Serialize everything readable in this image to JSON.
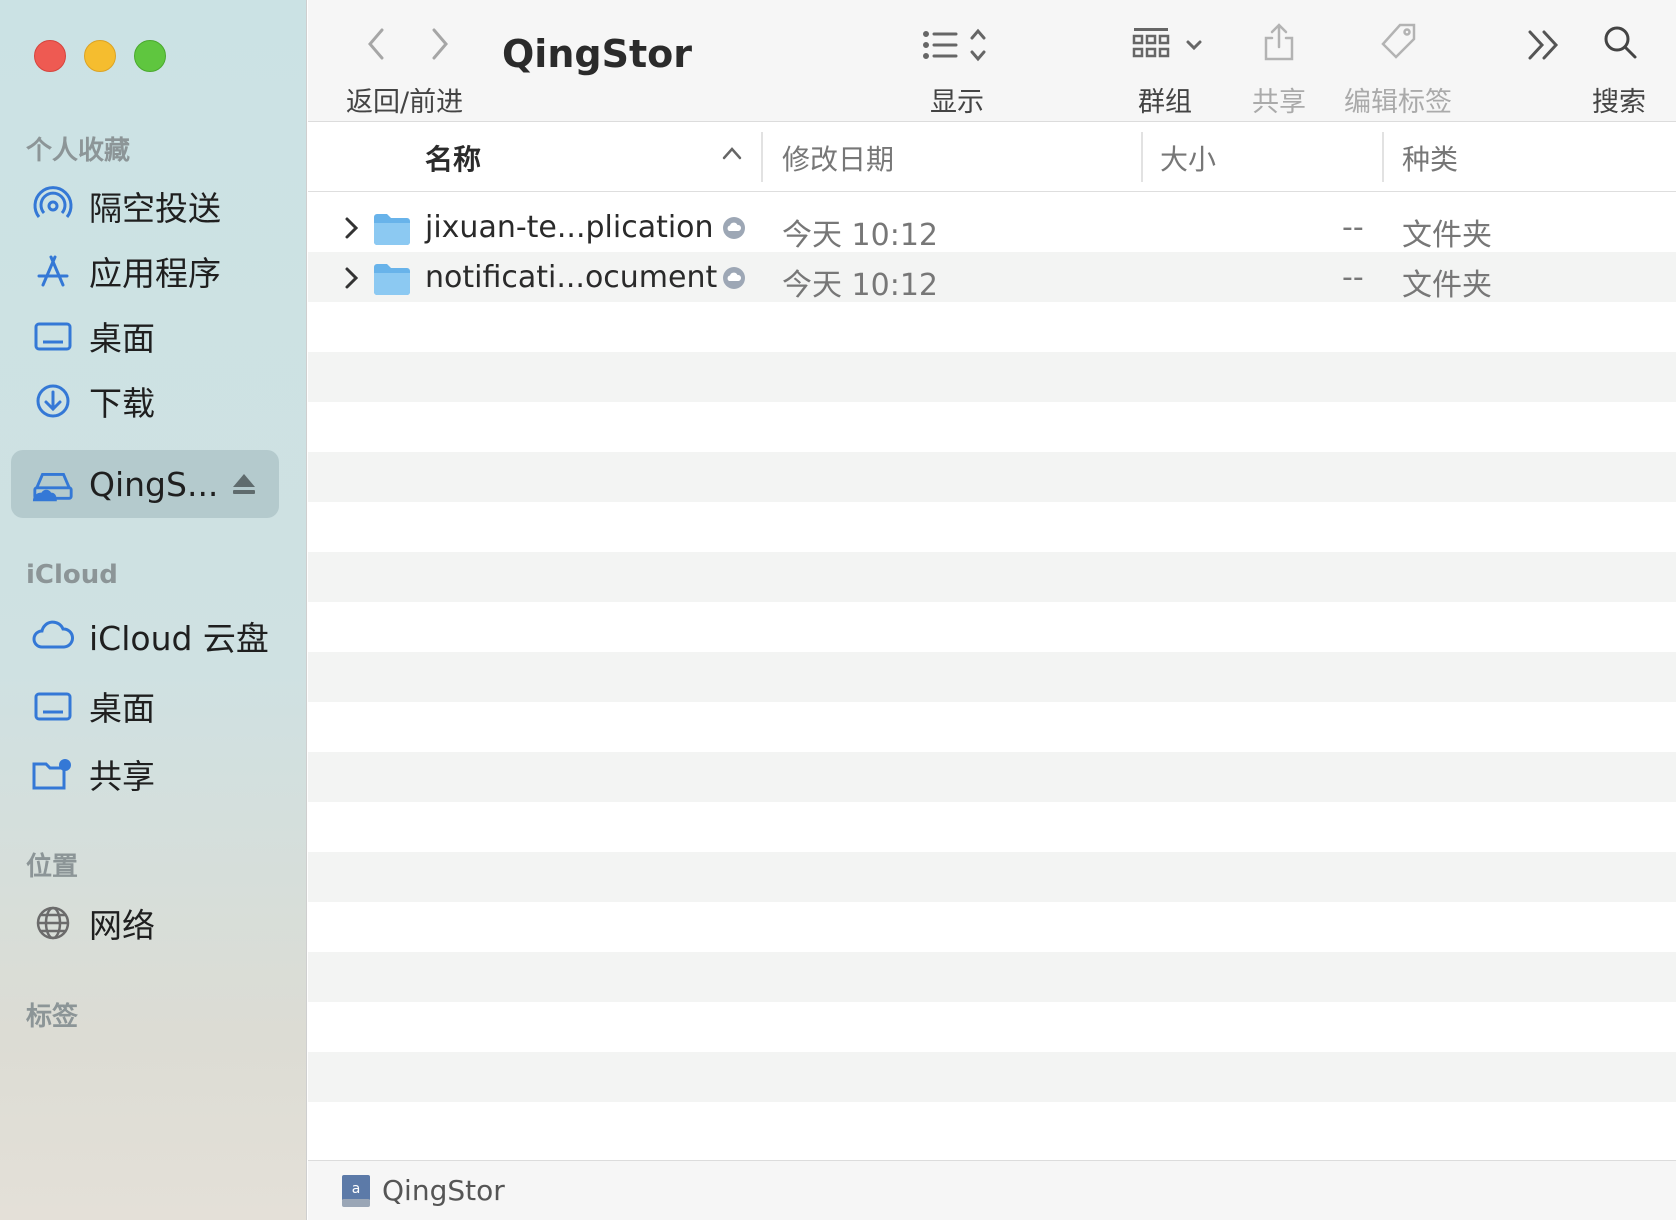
{
  "window": {
    "title": "QingStor"
  },
  "toolbar": {
    "nav_label": "返回/前进",
    "view_label": "显示",
    "group_label": "群组",
    "share_label": "共享",
    "tags_label": "编辑标签",
    "search_label": "搜索"
  },
  "sidebar": {
    "favorites_title": "个人收藏",
    "favorites": [
      {
        "label": "隔空投送",
        "icon": "airdrop-icon"
      },
      {
        "label": "应用程序",
        "icon": "applications-icon"
      },
      {
        "label": "桌面",
        "icon": "desktop-icon"
      },
      {
        "label": "下载",
        "icon": "download-icon"
      },
      {
        "label": "QingS...",
        "icon": "network-drive-icon",
        "selected": true
      }
    ],
    "icloud_title": "iCloud",
    "icloud": [
      {
        "label": "iCloud 云盘",
        "icon": "cloud-icon"
      },
      {
        "label": "桌面",
        "icon": "desktop-icon"
      },
      {
        "label": "共享",
        "icon": "shared-folder-icon"
      }
    ],
    "locations_title": "位置",
    "locations": [
      {
        "label": "网络",
        "icon": "globe-icon"
      }
    ],
    "tags_title": "标签"
  },
  "columns": {
    "name": "名称",
    "modified": "修改日期",
    "size": "大小",
    "kind": "种类"
  },
  "files": [
    {
      "name": "jixuan-te...plication",
      "modified": "今天 10:12",
      "size": "--",
      "kind": "文件夹"
    },
    {
      "name": "notificati...ocument",
      "modified": "今天 10:12",
      "size": "--",
      "kind": "文件夹"
    }
  ],
  "pathbar": {
    "label": "QingStor"
  },
  "colors": {
    "accent": "#3478d6",
    "sidebar_selected": "#b4cacd",
    "traffic_red": "#ee5a52",
    "traffic_yellow": "#f5bd2f",
    "traffic_green": "#5fc63f"
  }
}
